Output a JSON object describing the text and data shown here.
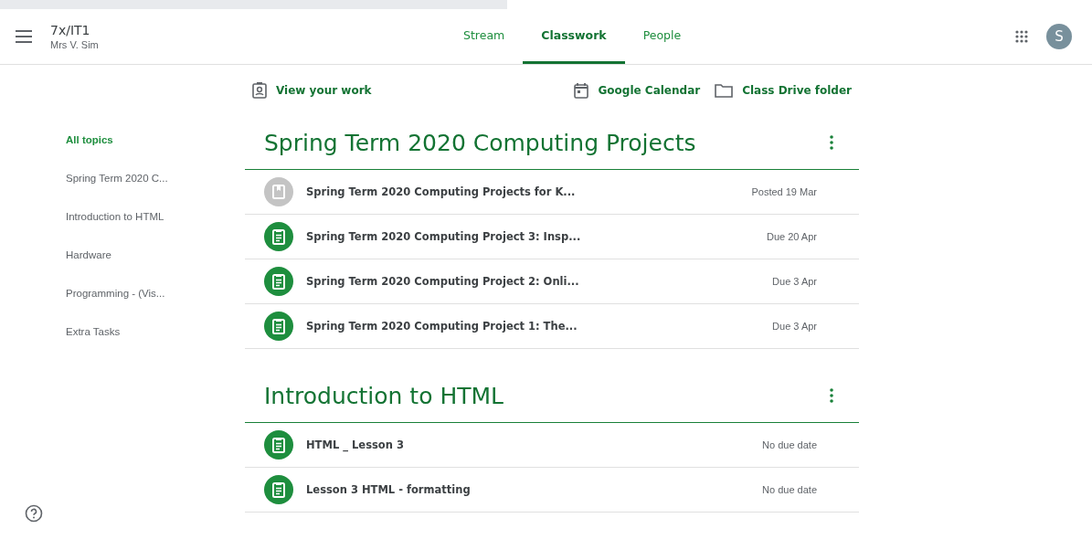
{
  "class": {
    "name": "7x/IT1",
    "teacher": "Mrs V. Sim"
  },
  "tabs": [
    {
      "label": "Stream",
      "selected": false
    },
    {
      "label": "Classwork",
      "selected": true
    },
    {
      "label": "People",
      "selected": false
    }
  ],
  "avatar": "S",
  "actions": {
    "view_work": "View your work",
    "calendar": "Google Calendar",
    "drive": "Class Drive folder"
  },
  "topics": [
    {
      "label": "All topics",
      "selected": true
    },
    {
      "label": "Spring Term 2020 C...",
      "selected": false
    },
    {
      "label": "Introduction to HTML",
      "selected": false
    },
    {
      "label": "Hardware",
      "selected": false
    },
    {
      "label": "Programming - (Vis...",
      "selected": false
    },
    {
      "label": "Extra Tasks",
      "selected": false
    }
  ],
  "sections": [
    {
      "title": "Spring Term 2020 Computing Projects",
      "items": [
        {
          "kind": "material",
          "title": "Spring Term 2020 Computing Projects for K...",
          "date": "Posted 19 Mar"
        },
        {
          "kind": "assignment",
          "title": "Spring Term 2020 Computing Project 3: Insp...",
          "date": "Due 20 Apr"
        },
        {
          "kind": "assignment",
          "title": "Spring Term 2020 Computing Project 2: Onli...",
          "date": "Due 3 Apr"
        },
        {
          "kind": "assignment",
          "title": "Spring Term 2020 Computing Project 1: The...",
          "date": "Due 3 Apr"
        }
      ]
    },
    {
      "title": "Introduction to HTML",
      "items": [
        {
          "kind": "assignment",
          "title": "HTML _ Lesson 3",
          "date": "No due date"
        },
        {
          "kind": "assignment",
          "title": "Lesson 3 HTML - formatting",
          "date": "No due date"
        }
      ]
    }
  ]
}
